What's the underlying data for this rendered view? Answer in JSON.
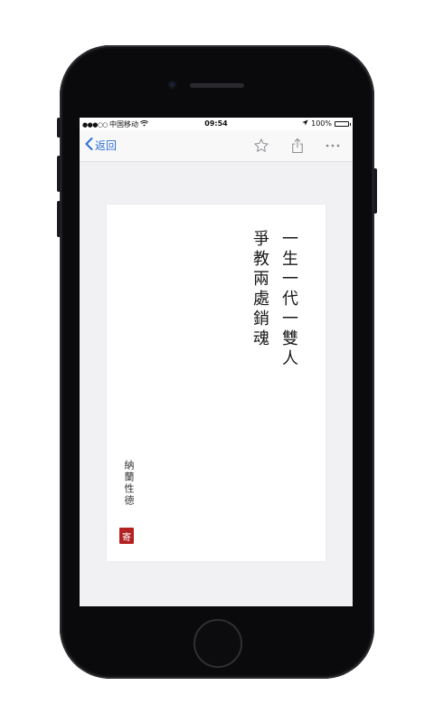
{
  "status_bar": {
    "carrier": "中国移动",
    "signal": "●●●○○",
    "time": "09:54",
    "battery_percent": "100%",
    "wifi_icon": "wifi-icon",
    "location_icon": "location-arrow-icon"
  },
  "nav": {
    "back_label": "返回",
    "accent_color": "#2f6fd6",
    "favorite_icon": "star-icon",
    "share_icon": "share-icon",
    "more_icon": "more-icon"
  },
  "poem": {
    "line_1": "一生一代一雙人",
    "line_2": "爭教兩處銷魂",
    "author": "納蘭性德",
    "seal_char": "寄",
    "seal_color": "#b22222"
  }
}
